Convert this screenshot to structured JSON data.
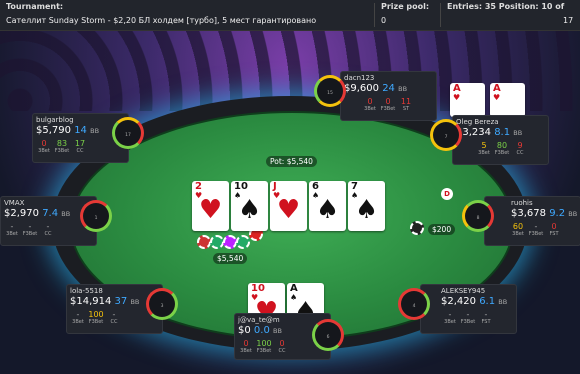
{
  "topbar": {
    "tournament_label": "Tournament:",
    "tournament_name": "Сателлит Sunday Storm - $2,20 БЛ холдем [турбо], 5 мест гарантировано",
    "prize_label": "Prize pool:",
    "prize_value": "0",
    "entries_label": "Entries: 35 Position: 10 of",
    "entries_value": "17"
  },
  "table": {
    "pot_label": "Pot: $5,540",
    "pot_chips": "$5,540",
    "bet_amount": "$200",
    "dealer_label": "D"
  },
  "board": [
    {
      "rank": "2",
      "suit": "♥",
      "color": "red"
    },
    {
      "rank": "10",
      "suit": "♠",
      "color": "blk"
    },
    {
      "rank": "J",
      "suit": "♥",
      "color": "red"
    },
    {
      "rank": "6",
      "suit": "♠",
      "color": "blk"
    },
    {
      "rank": "7",
      "suit": "♠",
      "color": "blk"
    }
  ],
  "hero_cards": [
    {
      "rank": "10",
      "suit": "♥",
      "color": "red"
    },
    {
      "rank": "A",
      "suit": "♠",
      "color": "blk"
    }
  ],
  "oleg_cards": [
    {
      "rank": "A",
      "suit": "♥",
      "color": "red"
    },
    {
      "rank": "A",
      "suit": "♥",
      "color": "red"
    }
  ],
  "players": {
    "dacn": {
      "name": "dacn123",
      "stack": "$9,600",
      "bb": "24",
      "bbl": "BB",
      "s1": "0",
      "s2": "0",
      "s3": "11",
      "l1": "3Bet",
      "l2": "F3Bet",
      "l3": "ST",
      "seat": "15"
    },
    "bulgar": {
      "name": "bulgarblog",
      "stack": "$5,790",
      "bb": "14",
      "bbl": "BB",
      "s1": "0",
      "s2": "83",
      "s3": "17",
      "l1": "3Bet",
      "l2": "F3Bet",
      "l3": "CC",
      "seat": "17"
    },
    "oleg": {
      "name": "Oleg Bereza",
      "stack": "$3,234",
      "bb": "8.1",
      "bbl": "BB",
      "s1": "5",
      "s2": "80",
      "s3": "9",
      "l1": "3Bet",
      "l2": "F3Bet",
      "l3": "CC",
      "seat": "7"
    },
    "vmax": {
      "name": "VMAX",
      "stack": "$2,970",
      "bb": "7.4",
      "bbl": "BB",
      "s1": "-",
      "s2": "-",
      "s3": "-",
      "l1": "3Bet",
      "l2": "F3Bet",
      "l3": "CC",
      "seat": "1"
    },
    "ruohis": {
      "name": "ruohis",
      "stack": "$3,678",
      "bb": "9.2",
      "bbl": "BB",
      "s1": "60",
      "s2": "-",
      "s3": "0",
      "l1": "3Bet",
      "l2": "F3Bet",
      "l3": "FST",
      "seat": "8"
    },
    "lola": {
      "name": "lola-5518",
      "stack": "$14,914",
      "bb": "37",
      "bbl": "BB",
      "s1": "-",
      "s2": "100",
      "s3": "-",
      "l1": "3Bet",
      "l2": "F3Bet",
      "l3": "CC",
      "seat": "3"
    },
    "aleksey": {
      "name": "ALEKSEY945",
      "stack": "$2,420",
      "bb": "6.1",
      "bbl": "BB",
      "s1": "-",
      "s2": "-",
      "s3": "-",
      "l1": "3Bet",
      "l2": "F3Bet",
      "l3": "FST",
      "seat": "4"
    },
    "hero": {
      "name": "j@va_te@m",
      "stack": "$0",
      "bb": "0.0",
      "bbl": "BB",
      "s1": "0",
      "s2": "100",
      "s3": "0",
      "l1": "3Bet",
      "l2": "F3Bet",
      "l3": "CC",
      "seat": "6"
    }
  },
  "colors": {
    "stack_bb": "#3fa9ff",
    "stat_red": "#e53935",
    "stat_yellow": "#f4c20d",
    "stat_green": "#7bd148",
    "rim_glow": "#28c8ff",
    "felt": "#2a8a40"
  }
}
